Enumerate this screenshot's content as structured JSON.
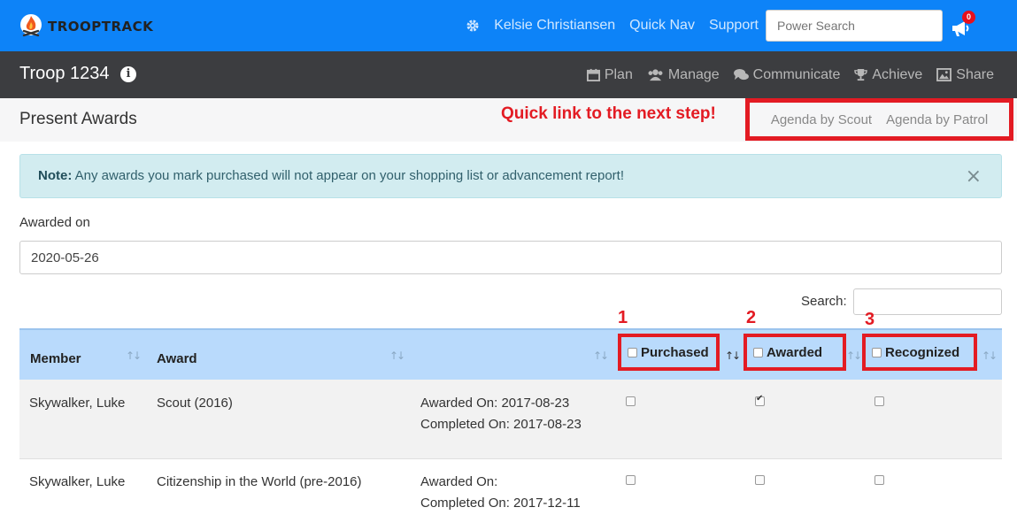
{
  "app": {
    "logo_text": "TROOPTRACK"
  },
  "topnav": {
    "user": "Kelsie Christiansen",
    "quick_nav": "Quick Nav",
    "support": "Support",
    "search_placeholder": "Power Search",
    "notification_count": "0"
  },
  "secnav": {
    "troop": "Troop 1234",
    "items": [
      {
        "label": "Plan",
        "icon": "calendar-icon"
      },
      {
        "label": "Manage",
        "icon": "users-icon"
      },
      {
        "label": "Communicate",
        "icon": "comments-icon"
      },
      {
        "label": "Achieve",
        "icon": "trophy-icon"
      },
      {
        "label": "Share",
        "icon": "image-icon"
      }
    ]
  },
  "page": {
    "title": "Present Awards",
    "callout": "Quick link to the next step!",
    "agenda_scout": "Agenda by Scout",
    "agenda_patrol": "Agenda by Patrol"
  },
  "alert": {
    "strong": "Note:",
    "text": " Any awards you mark purchased will not appear on your shopping list or advancement report!",
    "close": "×"
  },
  "form": {
    "awarded_on_label": "Awarded on",
    "awarded_on_value": "2020-05-26",
    "search_label": "Search:"
  },
  "table": {
    "headers": {
      "member": "Member",
      "award": "Award",
      "purchased": "Purchased",
      "awarded": "Awarded",
      "recognized": "Recognized"
    },
    "step_numbers": [
      "1",
      "2",
      "3"
    ],
    "rows": [
      {
        "member": "Skywalker, Luke",
        "award": "Scout (2016)",
        "awarded_on": "Awarded On: 2017-08-23",
        "completed_on": "Completed On: 2017-08-23",
        "purchased": false,
        "awarded": true,
        "recognized": false
      },
      {
        "member": "Skywalker, Luke",
        "award": "Citizenship in the World (pre-2016)",
        "awarded_on": "Awarded On:",
        "completed_on": "Completed On: 2017-12-11",
        "purchased": false,
        "awarded": false,
        "recognized": false
      }
    ]
  },
  "colors": {
    "topbar": "#0d83f8",
    "secbar": "#3c3d40",
    "accent_red": "#e31b23",
    "table_header": "#b9dafc",
    "alert_bg": "#d2ecf0"
  }
}
